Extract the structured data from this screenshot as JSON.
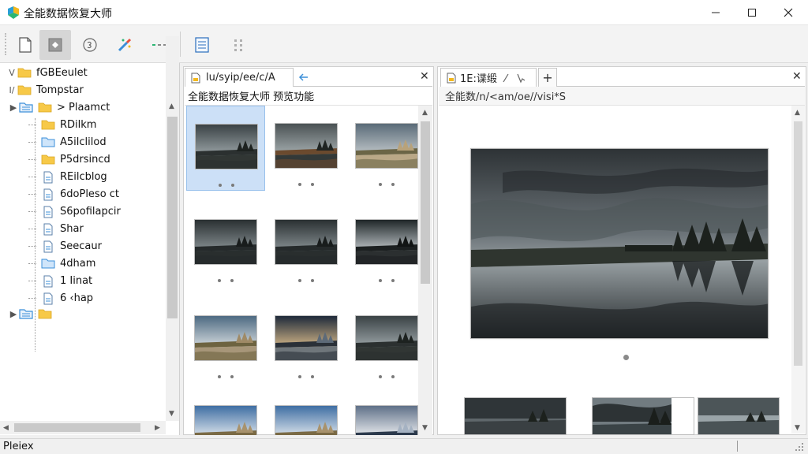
{
  "window": {
    "title": "全能数据恢复大师",
    "minimize_glyph": "—",
    "maximize_glyph": "☐",
    "close_glyph": "✕"
  },
  "toolbar": {
    "items": [
      {
        "icon": "document-icon"
      },
      {
        "icon": "scan-icon",
        "active": true
      },
      {
        "icon": "disk-icon"
      },
      {
        "icon": "magic-wand-icon"
      },
      {
        "icon": "dots-icon"
      },
      {
        "icon": "preview-pane-icon"
      },
      {
        "icon": "grid-dots-icon"
      }
    ]
  },
  "tree": {
    "items": [
      {
        "toggle": "V",
        "label": "fGBEeulet",
        "icon": "folder-icon"
      },
      {
        "toggle": "I/",
        "label": "Tompstar",
        "icon": "folder-icon"
      },
      {
        "toggle": "▶",
        "label": "> Plaamct",
        "icon": "folder-icon"
      },
      {
        "toggle": "",
        "label": "RDilkm",
        "icon": "folder-icon"
      },
      {
        "toggle": "",
        "label": "A5ilclilod",
        "icon": "blue-folder-icon"
      },
      {
        "toggle": "",
        "label": "P5drsincd",
        "icon": "folder-icon"
      },
      {
        "toggle": "",
        "label": "REilcblog",
        "icon": "file-icon"
      },
      {
        "toggle": "",
        "label": "6doPleso ct",
        "icon": "file-icon"
      },
      {
        "toggle": "",
        "label": "S6pofilapcir",
        "icon": "file-icon"
      },
      {
        "toggle": "",
        "label": "Shar",
        "icon": "file-icon"
      },
      {
        "toggle": "",
        "label": "Seecaur",
        "icon": "file-icon"
      },
      {
        "toggle": "",
        "label": "4dham",
        "icon": "blue-folder-icon"
      },
      {
        "toggle": "",
        "label": "1 Iinat",
        "icon": "file-icon"
      },
      {
        "toggle": "",
        "label": "6 ‹hap",
        "icon": "file-icon"
      },
      {
        "toggle": "▶",
        "label": "",
        "icon": "folder-icon"
      }
    ]
  },
  "middle": {
    "tab_label": "lu/syip/ee/c/A",
    "close_glyph": "✕",
    "header": "全能数据恢复大师 预览功能",
    "thumbnails": [
      {
        "scene": "lake-trees",
        "selected": true
      },
      {
        "scene": "lake-hills"
      },
      {
        "scene": "path-field"
      },
      {
        "scene": "lake-dark"
      },
      {
        "scene": "lake-dark"
      },
      {
        "scene": "lake-clouds"
      },
      {
        "scene": "path-hill"
      },
      {
        "scene": "river-sunset"
      },
      {
        "scene": "lake-trees"
      },
      {
        "scene": "road-sky"
      },
      {
        "scene": "road-sky"
      },
      {
        "scene": "lake-bright"
      }
    ]
  },
  "right": {
    "tab_label": "1E:谍缎",
    "add_glyph": "+",
    "close_glyph": "✕",
    "header": "全能数/n/<am/oe//visi*S"
  },
  "status": {
    "text": "Pleiex"
  },
  "colors": {
    "accent": "#0078d7",
    "selection": "#cce0f7",
    "folder": "#f7c948",
    "folder_blue": "#3b8fd9"
  }
}
